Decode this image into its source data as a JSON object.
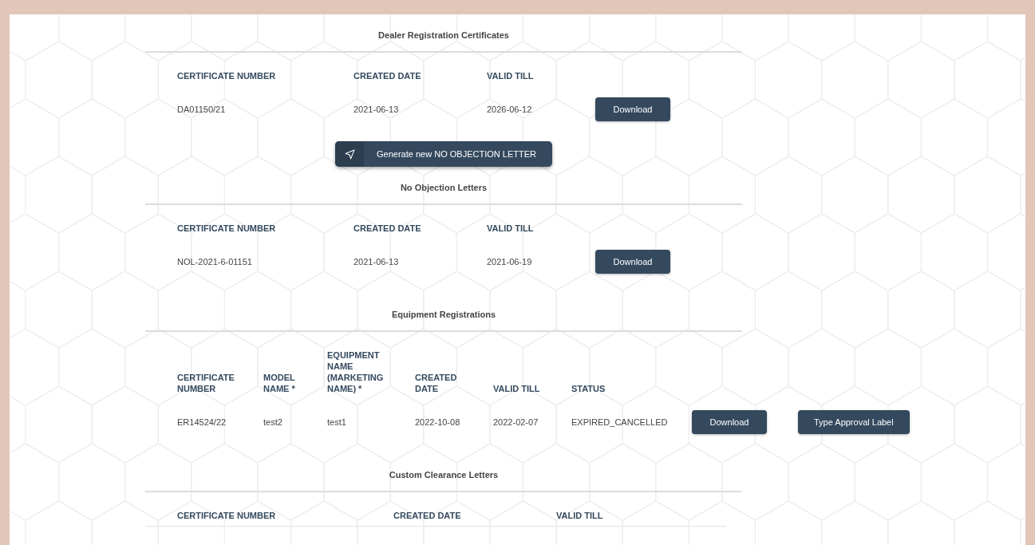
{
  "sections": [
    {
      "kind": "compact",
      "title": "Dealer Registration Certificates",
      "columns": [
        "CERTIFICATE NUMBER",
        "CREATED DATE",
        "VALID TILL"
      ],
      "rows": [
        {
          "cells": [
            "DA01150/21",
            "2021-06-13",
            "2026-06-12"
          ],
          "buttons": [
            "Download"
          ]
        }
      ]
    },
    {
      "kind": "compact",
      "action": {
        "label": "Generate new NO OBJECTION LETTER"
      },
      "title": "No Objection Letters",
      "columns": [
        "CERTIFICATE NUMBER",
        "CREATED DATE",
        "VALID TILL"
      ],
      "rows": [
        {
          "cells": [
            "NOL-2021-6-01151",
            "2021-06-13",
            "2021-06-19"
          ],
          "buttons": [
            "Download"
          ]
        }
      ]
    },
    {
      "kind": "detailed",
      "title": "Equipment Registrations",
      "columns": [
        "CERTIFICATE NUMBER",
        "MODEL NAME *",
        "EQUIPMENT NAME (MARKETING NAME) *",
        "CREATED DATE",
        "VALID TILL",
        "STATUS"
      ],
      "rows": [
        {
          "cells": [
            "ER14524/22",
            "test2",
            "test1",
            "2022-10-08",
            "2022-02-07",
            "EXPIRED_CANCELLED"
          ],
          "buttons": [
            "Download",
            "Type Approval Label"
          ]
        }
      ]
    },
    {
      "kind": "spread",
      "title": "Custom Clearance Letters",
      "columns": [
        "CERTIFICATE NUMBER",
        "CREATED DATE",
        "VALID TILL"
      ]
    }
  ]
}
